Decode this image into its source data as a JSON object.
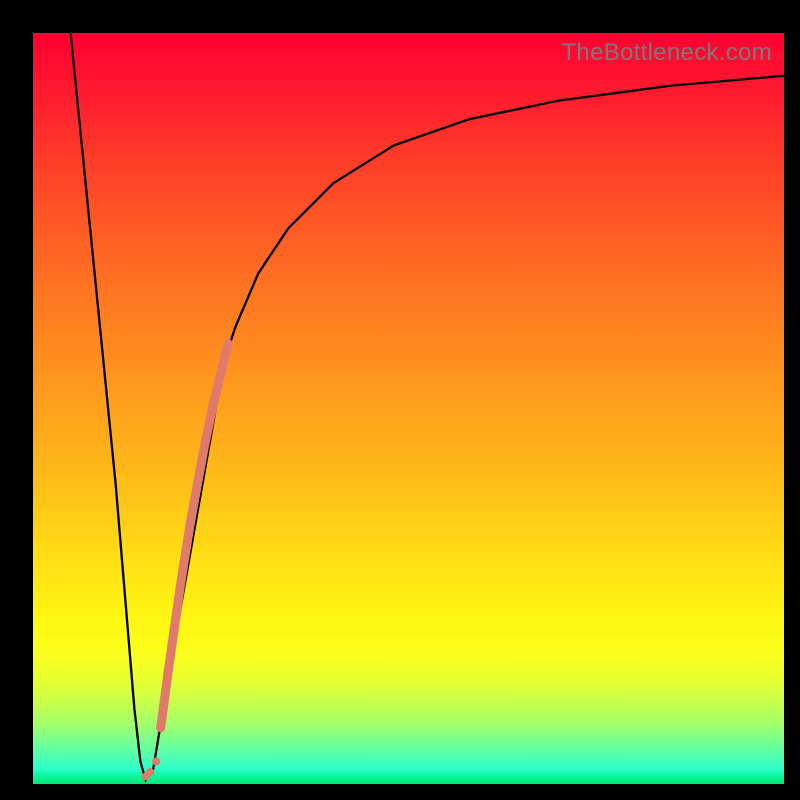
{
  "watermark": "TheBottleneck.com",
  "colors": {
    "dot": "#e07a6a",
    "line": "#000000",
    "frame": "#000000"
  },
  "chart_data": {
    "type": "line",
    "title": "",
    "xlabel": "",
    "ylabel": "",
    "xlim": [
      0,
      100
    ],
    "ylim": [
      0,
      100
    ],
    "series": [
      {
        "name": "bottleneck-curve",
        "x": [
          5,
          7,
          9,
          11,
          12.5,
          13.5,
          14.3,
          15,
          16,
          17,
          18,
          19.5,
          21,
          23,
          25,
          27,
          30,
          34,
          40,
          48,
          58,
          70,
          85,
          100
        ],
        "y": [
          100,
          80,
          60,
          40,
          22,
          10,
          3,
          0.5,
          2,
          8,
          15,
          25,
          35,
          47,
          55,
          61,
          68,
          74,
          80,
          85,
          88.5,
          91,
          93,
          94.3
        ]
      }
    ],
    "highlight_segment": {
      "name": "bottleneck-dots",
      "x": [
        17.0,
        17.5,
        18.0,
        18.5,
        19.0,
        19.5,
        20.0,
        20.5,
        21.0,
        21.5,
        22.0,
        22.5,
        23.0,
        23.5,
        24.0,
        24.5,
        25.0,
        25.5,
        26.0
      ],
      "y": [
        7.5,
        11.2,
        15.0,
        18.5,
        22.0,
        25.5,
        28.8,
        32.0,
        35.0,
        37.8,
        40.5,
        43.2,
        45.8,
        48.2,
        50.5,
        52.6,
        54.7,
        56.7,
        58.6
      ]
    },
    "scattered_dots": {
      "name": "outlier-dots",
      "x": [
        15.0,
        15.6,
        16.4
      ],
      "y": [
        1.0,
        1.6,
        3.0
      ]
    }
  }
}
